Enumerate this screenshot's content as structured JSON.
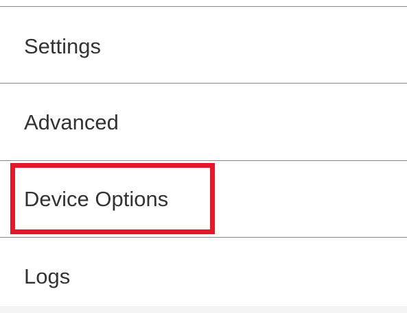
{
  "menu": {
    "items": [
      {
        "label": "Settings"
      },
      {
        "label": "Advanced"
      },
      {
        "label": "Device Options",
        "highlighted": true
      },
      {
        "label": "Logs"
      }
    ]
  },
  "colors": {
    "highlight": "#e3192b",
    "divider": "#8a8a8a",
    "text": "#333333"
  }
}
